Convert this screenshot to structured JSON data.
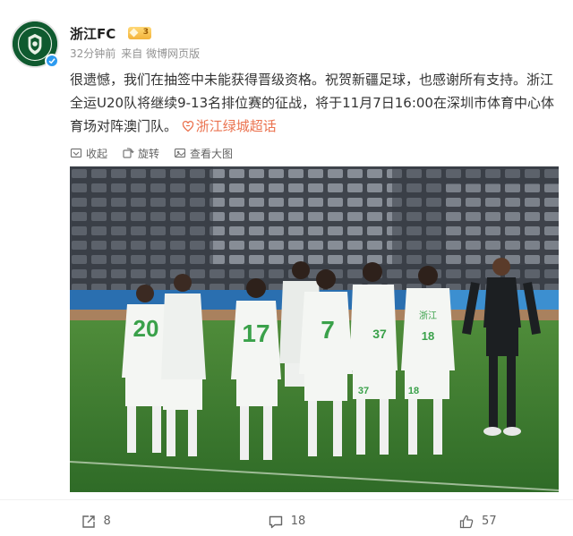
{
  "post": {
    "author": "浙江FC",
    "time": "32分钟前",
    "source": "来自 微博网页版",
    "avatar_text": "ZHEJIANG",
    "vip_level": "3",
    "text": "很遗憾，我们在抽签中未能获得晋级资格。祝贺新疆足球，也感谢所有支持。浙江全运U20队将继续9-13名排位赛的征战，将于11月7日16:00在深圳市体育中心体育场对阵澳门队。",
    "topic": "浙江绿城超话"
  },
  "image_toolbar": {
    "collect": "收起",
    "rotate": "旋转",
    "view_large": "查看大图"
  },
  "photo": {
    "numbers": [
      "20",
      "17",
      "7",
      "37",
      "18",
      "37",
      "18"
    ],
    "shirt_text": "浙江"
  },
  "actions": {
    "share": "8",
    "comment": "18",
    "like": "57"
  },
  "colors": {
    "accent": "#eb7350",
    "grass": "#3d7e2f",
    "kit": "#f4f6f3",
    "kit_number": "#3aa14a"
  }
}
